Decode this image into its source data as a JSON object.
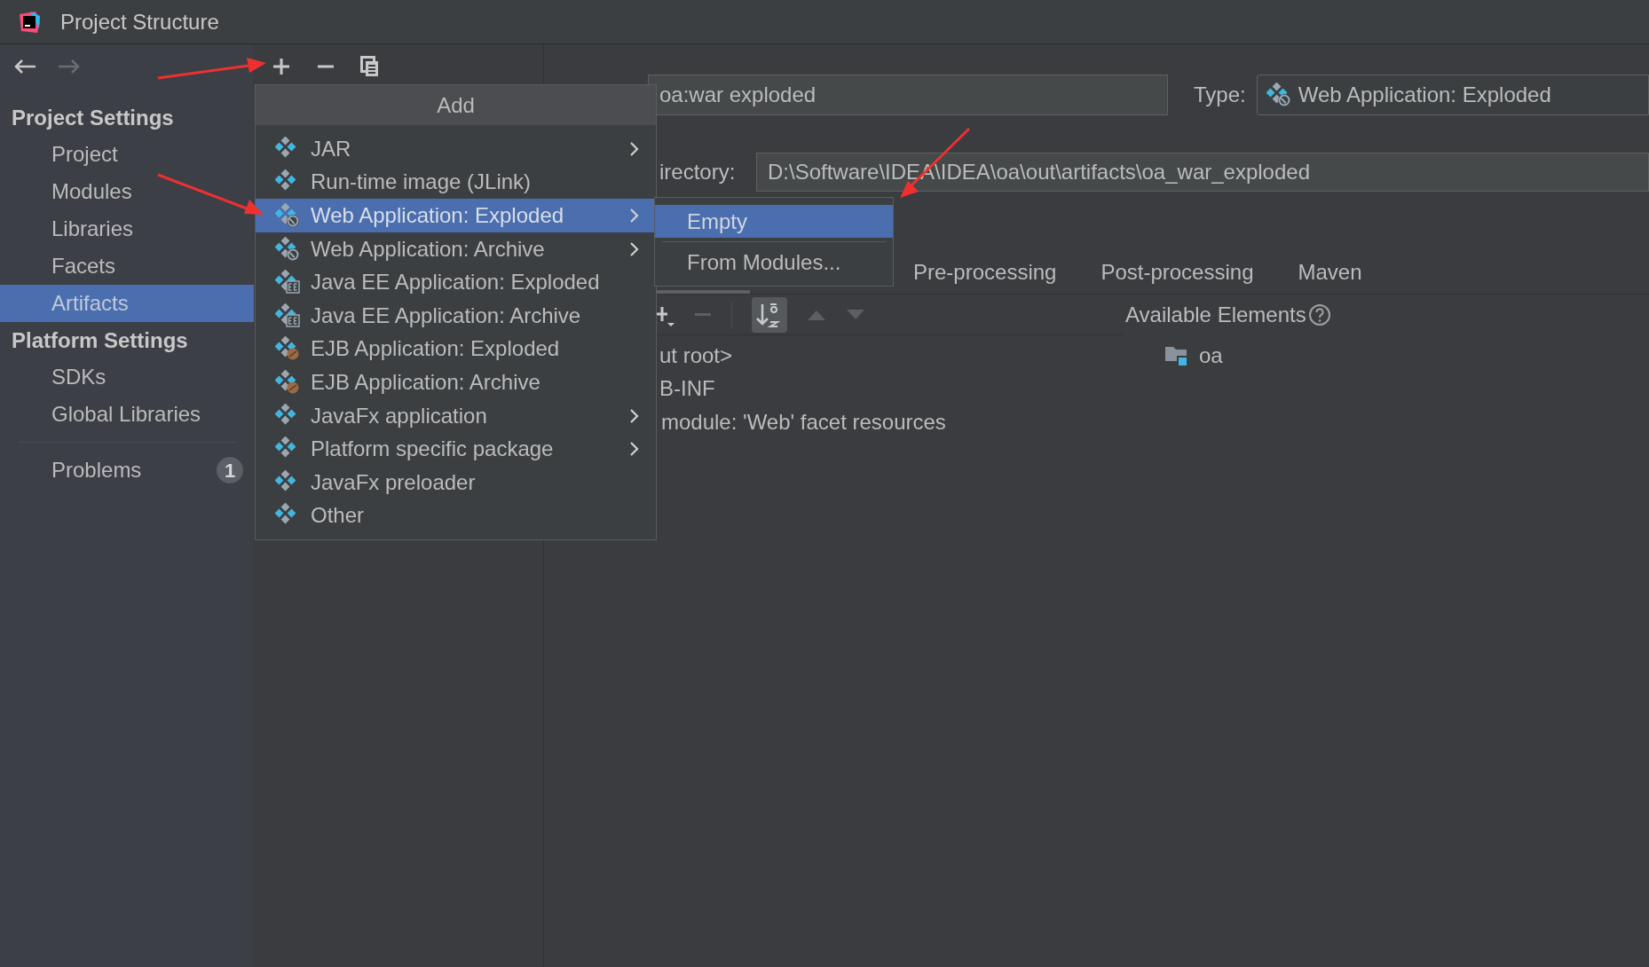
{
  "window": {
    "title": "Project Structure"
  },
  "sidebar": {
    "sections": [
      {
        "heading": "Project Settings",
        "items": [
          {
            "label": "Project",
            "selected": false
          },
          {
            "label": "Modules",
            "selected": false
          },
          {
            "label": "Libraries",
            "selected": false
          },
          {
            "label": "Facets",
            "selected": false
          },
          {
            "label": "Artifacts",
            "selected": true
          }
        ]
      },
      {
        "heading": "Platform Settings",
        "items": [
          {
            "label": "SDKs",
            "selected": false
          },
          {
            "label": "Global Libraries",
            "selected": false
          }
        ]
      }
    ],
    "problems": {
      "label": "Problems",
      "count": "1"
    }
  },
  "add_menu": {
    "title": "Add",
    "items": [
      {
        "label": "JAR",
        "kind": "plain",
        "has_submenu": true,
        "selected": false
      },
      {
        "label": "Run-time image (JLink)",
        "kind": "plain",
        "has_submenu": false,
        "selected": false
      },
      {
        "label": "Web Application: Exploded",
        "kind": "web",
        "has_submenu": true,
        "selected": true
      },
      {
        "label": "Web Application: Archive",
        "kind": "web",
        "has_submenu": true,
        "selected": false
      },
      {
        "label": "Java EE Application: Exploded",
        "kind": "ee",
        "has_submenu": false,
        "selected": false
      },
      {
        "label": "Java EE Application: Archive",
        "kind": "ee",
        "has_submenu": false,
        "selected": false
      },
      {
        "label": "EJB Application: Exploded",
        "kind": "ejb",
        "has_submenu": false,
        "selected": false
      },
      {
        "label": "EJB Application: Archive",
        "kind": "ejb",
        "has_submenu": false,
        "selected": false
      },
      {
        "label": "JavaFx application",
        "kind": "plain",
        "has_submenu": true,
        "selected": false
      },
      {
        "label": "Platform specific package",
        "kind": "plain",
        "has_submenu": true,
        "selected": false
      },
      {
        "label": "JavaFx preloader",
        "kind": "plain",
        "has_submenu": false,
        "selected": false
      },
      {
        "label": "Other",
        "kind": "plain",
        "has_submenu": false,
        "selected": false
      }
    ]
  },
  "submenu": {
    "items": [
      {
        "label": "Empty",
        "selected": true
      },
      {
        "label": "From Modules...",
        "selected": false
      }
    ]
  },
  "artifact": {
    "name": "oa:war exploded",
    "type_label": "Type:",
    "type_value": "Web Application: Exploded",
    "directory_label": "irectory:",
    "directory": "D:\\Software\\IDEA\\IDEA\\oa\\out\\artifacts\\oa_war_exploded"
  },
  "tabs": [
    {
      "label": "Pre-processing",
      "selected": false
    },
    {
      "label": "Post-processing",
      "selected": false
    },
    {
      "label": "Maven",
      "selected": false
    }
  ],
  "layout_tree": [
    "ut root>",
    "B-INF",
    "module: 'Web' facet resources"
  ],
  "available_elements": {
    "title": "Available Elements",
    "items": [
      "oa"
    ]
  }
}
